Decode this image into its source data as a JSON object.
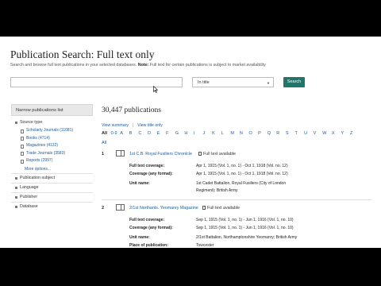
{
  "page": {
    "title": "Publication Search: Full text only",
    "subtitle_intro": "Search and browse full text publications in your selected databases.",
    "subtitle_note_label": "Note:",
    "subtitle_note": "Full text for certain publications is subject to market availability"
  },
  "search": {
    "value": "",
    "scope_selected": "In title",
    "button_label": "Search"
  },
  "sidebar": {
    "header": "Narrow publications list",
    "source_type_label": "Source type",
    "source_types": [
      {
        "label": "Scholarly Journals",
        "count": "(11081)"
      },
      {
        "label": "Books",
        "count": "(4714)"
      },
      {
        "label": "Magazines",
        "count": "(4132)"
      },
      {
        "label": "Trade Journals",
        "count": "(3583)"
      },
      {
        "label": "Reports",
        "count": "(2997)"
      }
    ],
    "more_options": "More options...",
    "facets": [
      "Publication subject",
      "Language",
      "Publisher",
      "Database"
    ]
  },
  "results": {
    "count": "30,447 publications",
    "view_summary": "View summary",
    "view_title_only": "View title only",
    "alphabet": [
      "All",
      "0-9",
      "A",
      "B",
      "C",
      "D",
      "E",
      "F",
      "G",
      "H",
      "I",
      "J",
      "K",
      "L",
      "M",
      "N",
      "O",
      "P",
      "Q",
      "R",
      "S",
      "T",
      "U",
      "V",
      "W",
      "X",
      "Y",
      "Z"
    ],
    "active_letter": "All",
    "all_label": "All",
    "items": [
      {
        "num": "1",
        "title": "1st C.B. Royal Fusiliers Chronicle",
        "full_text": "Full text available",
        "full_text_coverage_label": "Full text coverage:",
        "full_text_coverage": "Apr 1, 1915 (Vol. 1, no. 1) - Oct 1, 1918 (Vol. no. 12)",
        "coverage_any_label": "Coverage (any format):",
        "coverage_any": "Apr 1, 1915 (Vol. 1, no. 1) - Oct 1, 1918 (Vol. no. 12)",
        "unit_name_label": "Unit name:",
        "unit_name": "1st Cadet Battalion, Royal Fusiliers (City of London",
        "unit_name_2": "Regiment); British Army"
      },
      {
        "num": "2",
        "title": "2/1st Northants. Yeomanry Magazine",
        "full_text": "Full text available",
        "full_text_coverage_label": "Full text coverage:",
        "full_text_coverage": "Sep 1, 1915 (Vol. 1, no. 1) - Jun 1, 1916 (Vol. 1, no. 10)",
        "coverage_any_label": "Coverage (any format):",
        "coverage_any": "Sep 1, 1915 (Vol. 1, no. 1) - Jun 1, 1916 (Vol. 1, no. 10)",
        "unit_name_label": "Unit name:",
        "unit_name": "2/1st Battalion, Northamptonshire Yeomanry; British Army",
        "place_label": "Place of publication:",
        "place": "Towcester"
      }
    ]
  }
}
